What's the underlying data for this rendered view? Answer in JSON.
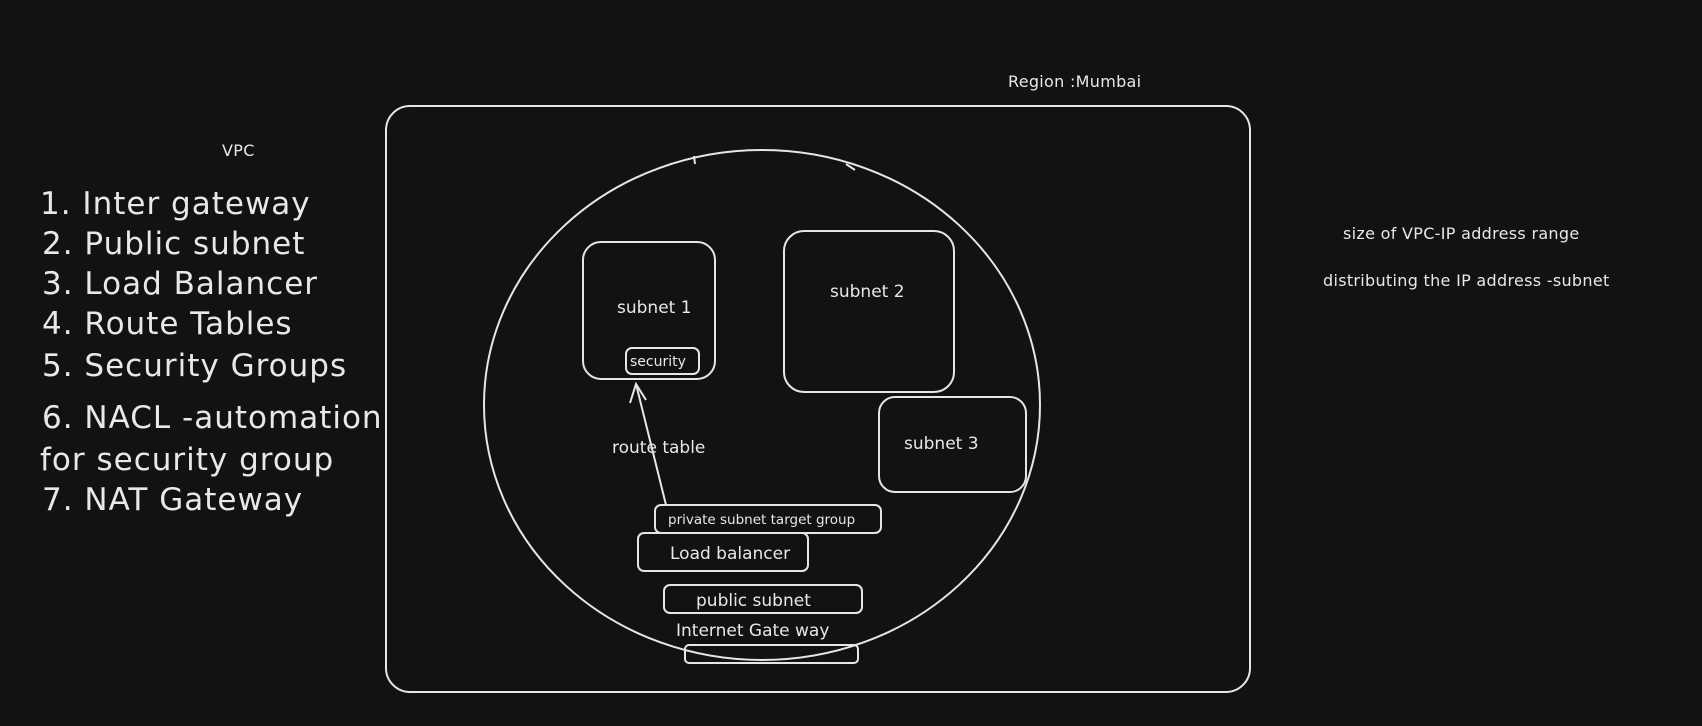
{
  "title_vpc": "VPC",
  "list": [
    "1. Inter gateway",
    "2. Public subnet",
    "3. Load Balancer",
    "4. Route Tables",
    "5. Security Groups",
    "6. NACL -automation",
    "for security group",
    "7. NAT Gateway"
  ],
  "region_label": "Region :Mumbai",
  "notes": {
    "size": "size of VPC-IP address range",
    "distributing": "distributing the IP address -subnet"
  },
  "subnets": {
    "subnet1": "subnet 1",
    "subnet2": "subnet 2",
    "subnet3": "subnet 3",
    "security": "security"
  },
  "route_table": "route table",
  "stack": {
    "private_target": "private subnet target group",
    "load_balancer": "Load balancer",
    "public_subnet": "public subnet",
    "internet_gateway": "Internet Gate way"
  }
}
